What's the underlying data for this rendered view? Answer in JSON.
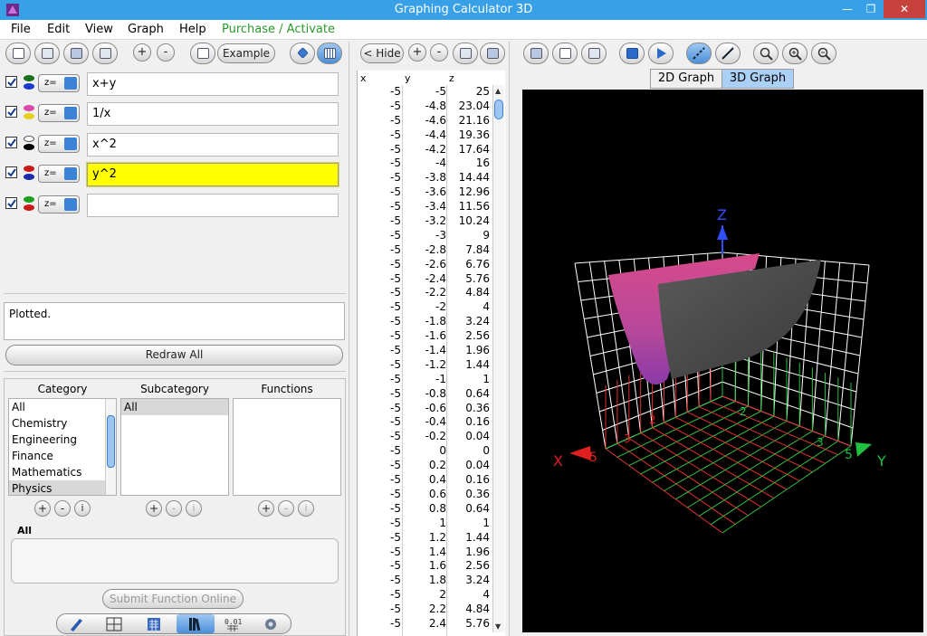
{
  "window": {
    "title": "Graphing Calculator 3D"
  },
  "menu": {
    "file": "File",
    "edit": "Edit",
    "view": "View",
    "graph": "Graph",
    "help": "Help",
    "purchase": "Purchase / Activate"
  },
  "toolbar": {
    "example_label": "Example",
    "plus": "+",
    "minus": "-",
    "hide_label": "< Hide"
  },
  "functions": [
    {
      "checked": true,
      "op": "z=",
      "expr": "x+y",
      "colors": [
        "#1a6f1a",
        "#1a3acc"
      ]
    },
    {
      "checked": true,
      "op": "z=",
      "expr": "1/x",
      "colors": [
        "#d94aa8",
        "#e8d020"
      ]
    },
    {
      "checked": true,
      "op": "z=",
      "expr": "x^2",
      "colors": [
        "#ffffff",
        "#000000"
      ]
    },
    {
      "checked": true,
      "op": "z=",
      "expr": "y^2",
      "colors": [
        "#cc1a1a",
        "#1a2aaa"
      ]
    },
    {
      "checked": true,
      "op": "z=",
      "expr": "",
      "colors": [
        "#1aa01a",
        "#cc1a1a"
      ]
    }
  ],
  "status": {
    "text": "Plotted."
  },
  "redraw_label": "Redraw All",
  "library": {
    "category_header": "Category",
    "subcategory_header": "Subcategory",
    "functions_header": "Functions",
    "categories": [
      "All",
      "Chemistry",
      "Engineering",
      "Finance",
      "Mathematics",
      "Physics"
    ],
    "selected_category": "Physics",
    "subcategories": [
      "All"
    ],
    "selected_label": "All",
    "submit_label": "Submit Function Online"
  },
  "table": {
    "headers": [
      "x",
      "y",
      "z"
    ],
    "rows": [
      [
        "-5",
        "-5",
        "25"
      ],
      [
        "-5",
        "-4.8",
        "23.04"
      ],
      [
        "-5",
        "-4.6",
        "21.16"
      ],
      [
        "-5",
        "-4.4",
        "19.36"
      ],
      [
        "-5",
        "-4.2",
        "17.64"
      ],
      [
        "-5",
        "-4",
        "16"
      ],
      [
        "-5",
        "-3.8",
        "14.44"
      ],
      [
        "-5",
        "-3.6",
        "12.96"
      ],
      [
        "-5",
        "-3.4",
        "11.56"
      ],
      [
        "-5",
        "-3.2",
        "10.24"
      ],
      [
        "-5",
        "-3",
        "9"
      ],
      [
        "-5",
        "-2.8",
        "7.84"
      ],
      [
        "-5",
        "-2.6",
        "6.76"
      ],
      [
        "-5",
        "-2.4",
        "5.76"
      ],
      [
        "-5",
        "-2.2",
        "4.84"
      ],
      [
        "-5",
        "-2",
        "4"
      ],
      [
        "-5",
        "-1.8",
        "3.24"
      ],
      [
        "-5",
        "-1.6",
        "2.56"
      ],
      [
        "-5",
        "-1.4",
        "1.96"
      ],
      [
        "-5",
        "-1.2",
        "1.44"
      ],
      [
        "-5",
        "-1",
        "1"
      ],
      [
        "-5",
        "-0.8",
        "0.64"
      ],
      [
        "-5",
        "-0.6",
        "0.36"
      ],
      [
        "-5",
        "-0.4",
        "0.16"
      ],
      [
        "-5",
        "-0.2",
        "0.04"
      ],
      [
        "-5",
        "0",
        "0"
      ],
      [
        "-5",
        "0.2",
        "0.04"
      ],
      [
        "-5",
        "0.4",
        "0.16"
      ],
      [
        "-5",
        "0.6",
        "0.36"
      ],
      [
        "-5",
        "0.8",
        "0.64"
      ],
      [
        "-5",
        "1",
        "1"
      ],
      [
        "-5",
        "1.2",
        "1.44"
      ],
      [
        "-5",
        "1.4",
        "1.96"
      ],
      [
        "-5",
        "1.6",
        "2.56"
      ],
      [
        "-5",
        "1.8",
        "3.24"
      ],
      [
        "-5",
        "2",
        "4"
      ],
      [
        "-5",
        "2.2",
        "4.84"
      ],
      [
        "-5",
        "2.4",
        "5.76"
      ]
    ]
  },
  "graph": {
    "tab_2d": "2D Graph",
    "tab_3d": "3D Graph",
    "active_tab": "3D Graph",
    "axis_x": "X",
    "axis_y": "Y",
    "axis_z": "Z",
    "tick_5": "5",
    "tick_3": "3",
    "tick_2": "2"
  }
}
